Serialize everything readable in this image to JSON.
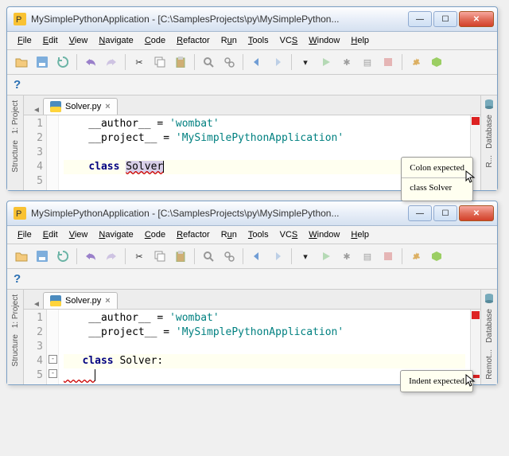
{
  "windows": [
    {
      "title": "MySimplePythonApplication - [C:\\SamplesProjects\\py\\MySimplePython...",
      "tab": "Solver.py",
      "gutter": [
        "1",
        "2",
        "3",
        "4",
        "5"
      ],
      "hl": 4,
      "lines": {
        "l1a": "    __author__ ",
        "l1b": "= ",
        "l1c": "'wombat'",
        "l2a": "    __project__ ",
        "l2b": "= ",
        "l2c": "'MySimplePythonApplication'",
        "l3": " ",
        "l4a": "    ",
        "l4k": "class",
        "l4s": " ",
        "l4id": "Solver",
        "l5": " "
      },
      "tip1": "Colon expected",
      "tip2": "class Solver",
      "has_fold": false
    },
    {
      "title": "MySimplePythonApplication - [C:\\SamplesProjects\\py\\MySimplePython...",
      "tab": "Solver.py",
      "gutter": [
        "1",
        "2",
        "3",
        "4",
        "5"
      ],
      "hl": 4,
      "lines": {
        "l1a": "    __author__ ",
        "l1b": "= ",
        "l1c": "'wombat'",
        "l2a": "    __project__ ",
        "l2b": "= ",
        "l2c": "'MySimplePythonApplication'",
        "l3": " ",
        "l4a": "   ",
        "l4k": "class",
        "l4s": " ",
        "l4id": "Solver",
        "l4e": ":",
        "l5": "     "
      },
      "tip1": "Indent expected",
      "has_fold": true
    }
  ],
  "menu": {
    "file": "File",
    "edit": "Edit",
    "view": "View",
    "navigate": "Navigate",
    "code": "Code",
    "refactor": "Refactor",
    "run": "Run",
    "tools": "Tools",
    "vcs": "VCS",
    "window": "Window",
    "help": "Help"
  },
  "sidebars": {
    "project": "1: Project",
    "structure": "Structure",
    "database": "Database",
    "re": "R...",
    "remote": "Remot..."
  },
  "help": "?"
}
